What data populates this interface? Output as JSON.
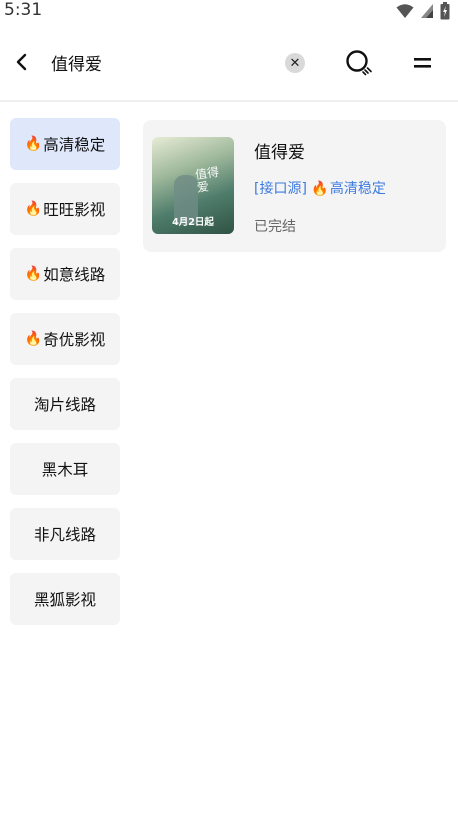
{
  "status_bar": {
    "time": "5:31",
    "icons": [
      "wifi-icon",
      "signal-icon",
      "battery-icon"
    ]
  },
  "top_bar": {
    "search_value": "值得爱",
    "icons": [
      "back-arrow-icon",
      "clear-icon",
      "search-icon",
      "menu-icon"
    ]
  },
  "sources": [
    {
      "label": "高清稳定",
      "hot": true,
      "active": true
    },
    {
      "label": "旺旺影视",
      "hot": true,
      "active": false
    },
    {
      "label": "如意线路",
      "hot": true,
      "active": false
    },
    {
      "label": "奇优影视",
      "hot": true,
      "active": false
    },
    {
      "label": "淘片线路",
      "hot": false,
      "active": false
    },
    {
      "label": "黑木耳",
      "hot": false,
      "active": false
    },
    {
      "label": "非凡线路",
      "hot": false,
      "active": false
    },
    {
      "label": "黑狐影视",
      "hot": false,
      "active": false
    }
  ],
  "fire_glyph": "🔥",
  "result": {
    "title": "值得爱",
    "source_prefix": "[接口源]",
    "source_name": "高清稳定",
    "status": "已完结",
    "poster_title": "值得爱",
    "poster_date": "4月2日起"
  },
  "colors": {
    "accent": "#3d7be0",
    "active_bg": "#dfe8fb",
    "item_bg": "#f4f4f4"
  }
}
